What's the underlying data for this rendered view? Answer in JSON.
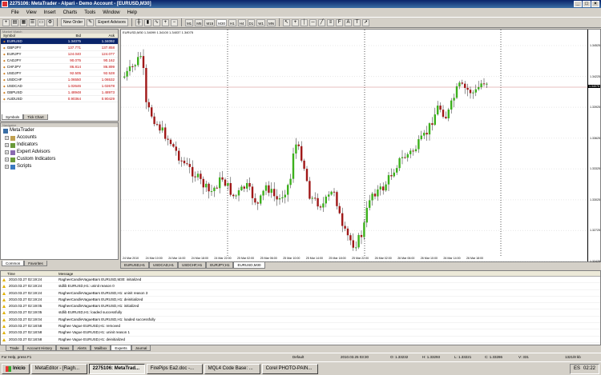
{
  "window": {
    "title": "2275106: MetaTrader - Alpari - Demo Account - [EURUSD,M30]"
  },
  "menu": [
    "File",
    "View",
    "Insert",
    "Charts",
    "Tools",
    "Window",
    "Help"
  ],
  "toolbar": {
    "new_order": "New Order",
    "expert_advisors": "Expert Advisors",
    "timeframes": [
      "M1",
      "M5",
      "M15",
      "M30",
      "H1",
      "H4",
      "D1",
      "W1",
      "MN"
    ],
    "selected_timeframe": "M30"
  },
  "market_watch": {
    "caption": "Market Watch",
    "headers": {
      "symbol": "Symbol",
      "bid": "Bid",
      "ask": "Ask"
    },
    "rows": [
      {
        "symbol": "EURUSD",
        "bid": "1.34075",
        "ask": "1.34092"
      },
      {
        "symbol": "GBPJPY",
        "bid": "137.771",
        "ask": "137.858"
      },
      {
        "symbol": "EURJPY",
        "bid": "124.040",
        "ask": "124.077"
      },
      {
        "symbol": "CADJPY",
        "bid": "90.075",
        "ask": "90.162"
      },
      {
        "symbol": "CHFJPY",
        "bid": "86.814",
        "ask": "86.899"
      },
      {
        "symbol": "USDJPY",
        "bid": "92.505",
        "ask": "92.528"
      },
      {
        "symbol": "USDCHF",
        "bid": "1.06550",
        "ask": "1.06532"
      },
      {
        "symbol": "USDCAD",
        "bid": "1.02646",
        "ask": "1.02678"
      },
      {
        "symbol": "GBPUSD",
        "bid": "1.48948",
        "ask": "1.48973"
      },
      {
        "symbol": "AUDUSD",
        "bid": "0.90364",
        "ask": "0.90429"
      }
    ],
    "tabs": [
      "Symbols",
      "Tick Chart"
    ]
  },
  "navigator": {
    "caption": "Navigator",
    "root": "MetaTrader",
    "items": [
      "Accounts",
      "Indicators",
      "Expert Advisors",
      "Custom Indicators",
      "Scripts"
    ],
    "tabs": [
      "Common",
      "Favorites"
    ]
  },
  "chart": {
    "header": "EURUSD,M30  1.34099 1.34100 1.34037 1.34075",
    "current_price": "1.34075",
    "y_ticks": [
      "1.34525",
      "1.34225",
      "1.33925",
      "1.33625",
      "1.33325",
      "1.33025",
      "1.32725",
      "1.32425"
    ],
    "x_ticks": [
      "24 Mar 2010",
      "24 Mar 10:00",
      "24 Mar 14:00",
      "24 Mar 18:00",
      "24 Mar 22:00",
      "25 Mar 02:00",
      "25 Mar 06:00",
      "25 Mar 10:00",
      "25 Mar 14:00",
      "25 Mar 18:00",
      "25 Mar 22:00",
      "26 Mar 02:00",
      "26 Mar 06:00",
      "26 Mar 10:00",
      "26 Mar 14:00",
      "26 Mar 18:00"
    ],
    "bull_color": "#3cb01c",
    "bear_color": "#a01818",
    "tabs": [
      "EURUSD,H1",
      "USDCAD,H1",
      "USDCHF,H1",
      "EURJPY,H1",
      "EURUSD,M30"
    ],
    "active_tab": "EURUSD,M30"
  },
  "terminal": {
    "headers": {
      "time": "Time",
      "message": "Message"
    },
    "rows": [
      {
        "time": "2010.03.27 02:19:24",
        "msg": "RagheeCandleVagueBars EURUSD,M30: initialized"
      },
      {
        "time": "2010.03.27 02:19:24",
        "msg": "stdlib EURUSD,H1: uninit reason 0"
      },
      {
        "time": "2010.03.27 02:19:24",
        "msg": "RagheeCandleVagueBars EURUSD,H1: uninit reason 3"
      },
      {
        "time": "2010.03.27 02:19:24",
        "msg": "RagheeCandleVagueBars EURUSD,H1: deinitialized"
      },
      {
        "time": "2010.03.27 02:19:05",
        "msg": "RagheeCandleVagueBars EURUSD,H1: initialized"
      },
      {
        "time": "2010.03.27 02:19:05",
        "msg": "stdlib EURUSD,H1: loaded successfully"
      },
      {
        "time": "2010.03.27 02:19:04",
        "msg": "RagheeCandleVagueBars EURUSD,H1: loaded successfully"
      },
      {
        "time": "2010.03.27 02:18:58",
        "msg": "Raghee Vague EURUSD,H1: removed"
      },
      {
        "time": "2010.03.27 02:18:58",
        "msg": "Raghee Vague EURUSD,H1: uninit reason 1"
      },
      {
        "time": "2010.03.27 02:18:58",
        "msg": "Raghee Vague EURUSD,H1: deinitialized"
      }
    ],
    "tabs": [
      "Trade",
      "Account History",
      "News",
      "Alerts",
      "Mailbox",
      "Experts",
      "Journal"
    ],
    "active_tab": "Experts"
  },
  "status": {
    "help": "For Help, press F1",
    "profile": "Default",
    "datetime": "2010.03.25 03:30",
    "open": "O: 1.33232",
    "high": "H: 1.33293",
    "low": "L: 1.33221",
    "close": "C: 1.33286",
    "volume": "V: 331",
    "traffic": "1321/8 kb"
  },
  "taskbar": {
    "start": "Inicio",
    "tasks": [
      "MetaEditor - [Ragh...",
      "2275106: MetaTrad...",
      "FirePips Ea2.doc -...",
      "MQL4 Code Base: ...",
      "Corel PHOTO-PAIN..."
    ],
    "active_task": 1,
    "lang": "ES",
    "clock": "02:22"
  }
}
